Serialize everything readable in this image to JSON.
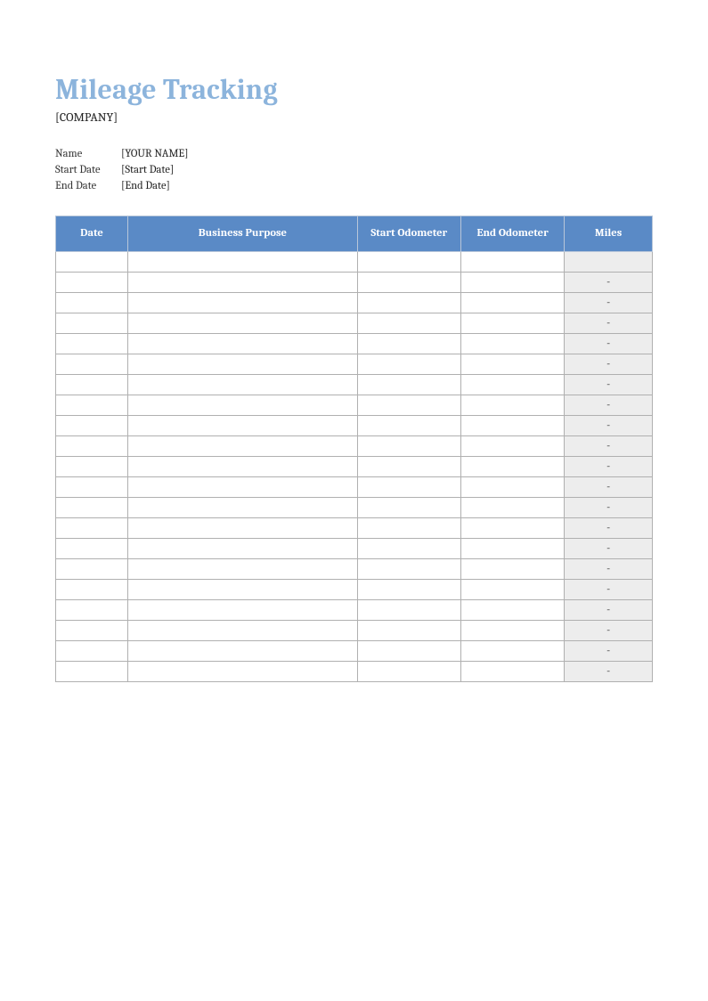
{
  "header": {
    "title": "Mileage Tracking",
    "company": "[COMPANY]"
  },
  "meta": {
    "name_label": "Name",
    "name_value": "[YOUR NAME]",
    "start_label": "Start Date",
    "start_value": "[Start Date]",
    "end_label": "End Date",
    "end_value": "[End Date]"
  },
  "table": {
    "columns": {
      "date": "Date",
      "purpose": "Business Purpose",
      "start_odometer": "Start Odometer",
      "end_odometer": "End Odometer",
      "miles": "Miles"
    },
    "rows": [
      {
        "date": "",
        "purpose": "",
        "start_odometer": "",
        "end_odometer": "",
        "miles": ""
      },
      {
        "date": "",
        "purpose": "",
        "start_odometer": "",
        "end_odometer": "",
        "miles": "-"
      },
      {
        "date": "",
        "purpose": "",
        "start_odometer": "",
        "end_odometer": "",
        "miles": "-"
      },
      {
        "date": "",
        "purpose": "",
        "start_odometer": "",
        "end_odometer": "",
        "miles": "-"
      },
      {
        "date": "",
        "purpose": "",
        "start_odometer": "",
        "end_odometer": "",
        "miles": "-"
      },
      {
        "date": "",
        "purpose": "",
        "start_odometer": "",
        "end_odometer": "",
        "miles": "-"
      },
      {
        "date": "",
        "purpose": "",
        "start_odometer": "",
        "end_odometer": "",
        "miles": "-"
      },
      {
        "date": "",
        "purpose": "",
        "start_odometer": "",
        "end_odometer": "",
        "miles": "-"
      },
      {
        "date": "",
        "purpose": "",
        "start_odometer": "",
        "end_odometer": "",
        "miles": "-"
      },
      {
        "date": "",
        "purpose": "",
        "start_odometer": "",
        "end_odometer": "",
        "miles": "-"
      },
      {
        "date": "",
        "purpose": "",
        "start_odometer": "",
        "end_odometer": "",
        "miles": "-"
      },
      {
        "date": "",
        "purpose": "",
        "start_odometer": "",
        "end_odometer": "",
        "miles": "-"
      },
      {
        "date": "",
        "purpose": "",
        "start_odometer": "",
        "end_odometer": "",
        "miles": "-"
      },
      {
        "date": "",
        "purpose": "",
        "start_odometer": "",
        "end_odometer": "",
        "miles": "-"
      },
      {
        "date": "",
        "purpose": "",
        "start_odometer": "",
        "end_odometer": "",
        "miles": "-"
      },
      {
        "date": "",
        "purpose": "",
        "start_odometer": "",
        "end_odometer": "",
        "miles": "-"
      },
      {
        "date": "",
        "purpose": "",
        "start_odometer": "",
        "end_odometer": "",
        "miles": "-"
      },
      {
        "date": "",
        "purpose": "",
        "start_odometer": "",
        "end_odometer": "",
        "miles": "-"
      },
      {
        "date": "",
        "purpose": "",
        "start_odometer": "",
        "end_odometer": "",
        "miles": "-"
      },
      {
        "date": "",
        "purpose": "",
        "start_odometer": "",
        "end_odometer": "",
        "miles": "-"
      },
      {
        "date": "",
        "purpose": "",
        "start_odometer": "",
        "end_odometer": "",
        "miles": "-"
      }
    ]
  }
}
